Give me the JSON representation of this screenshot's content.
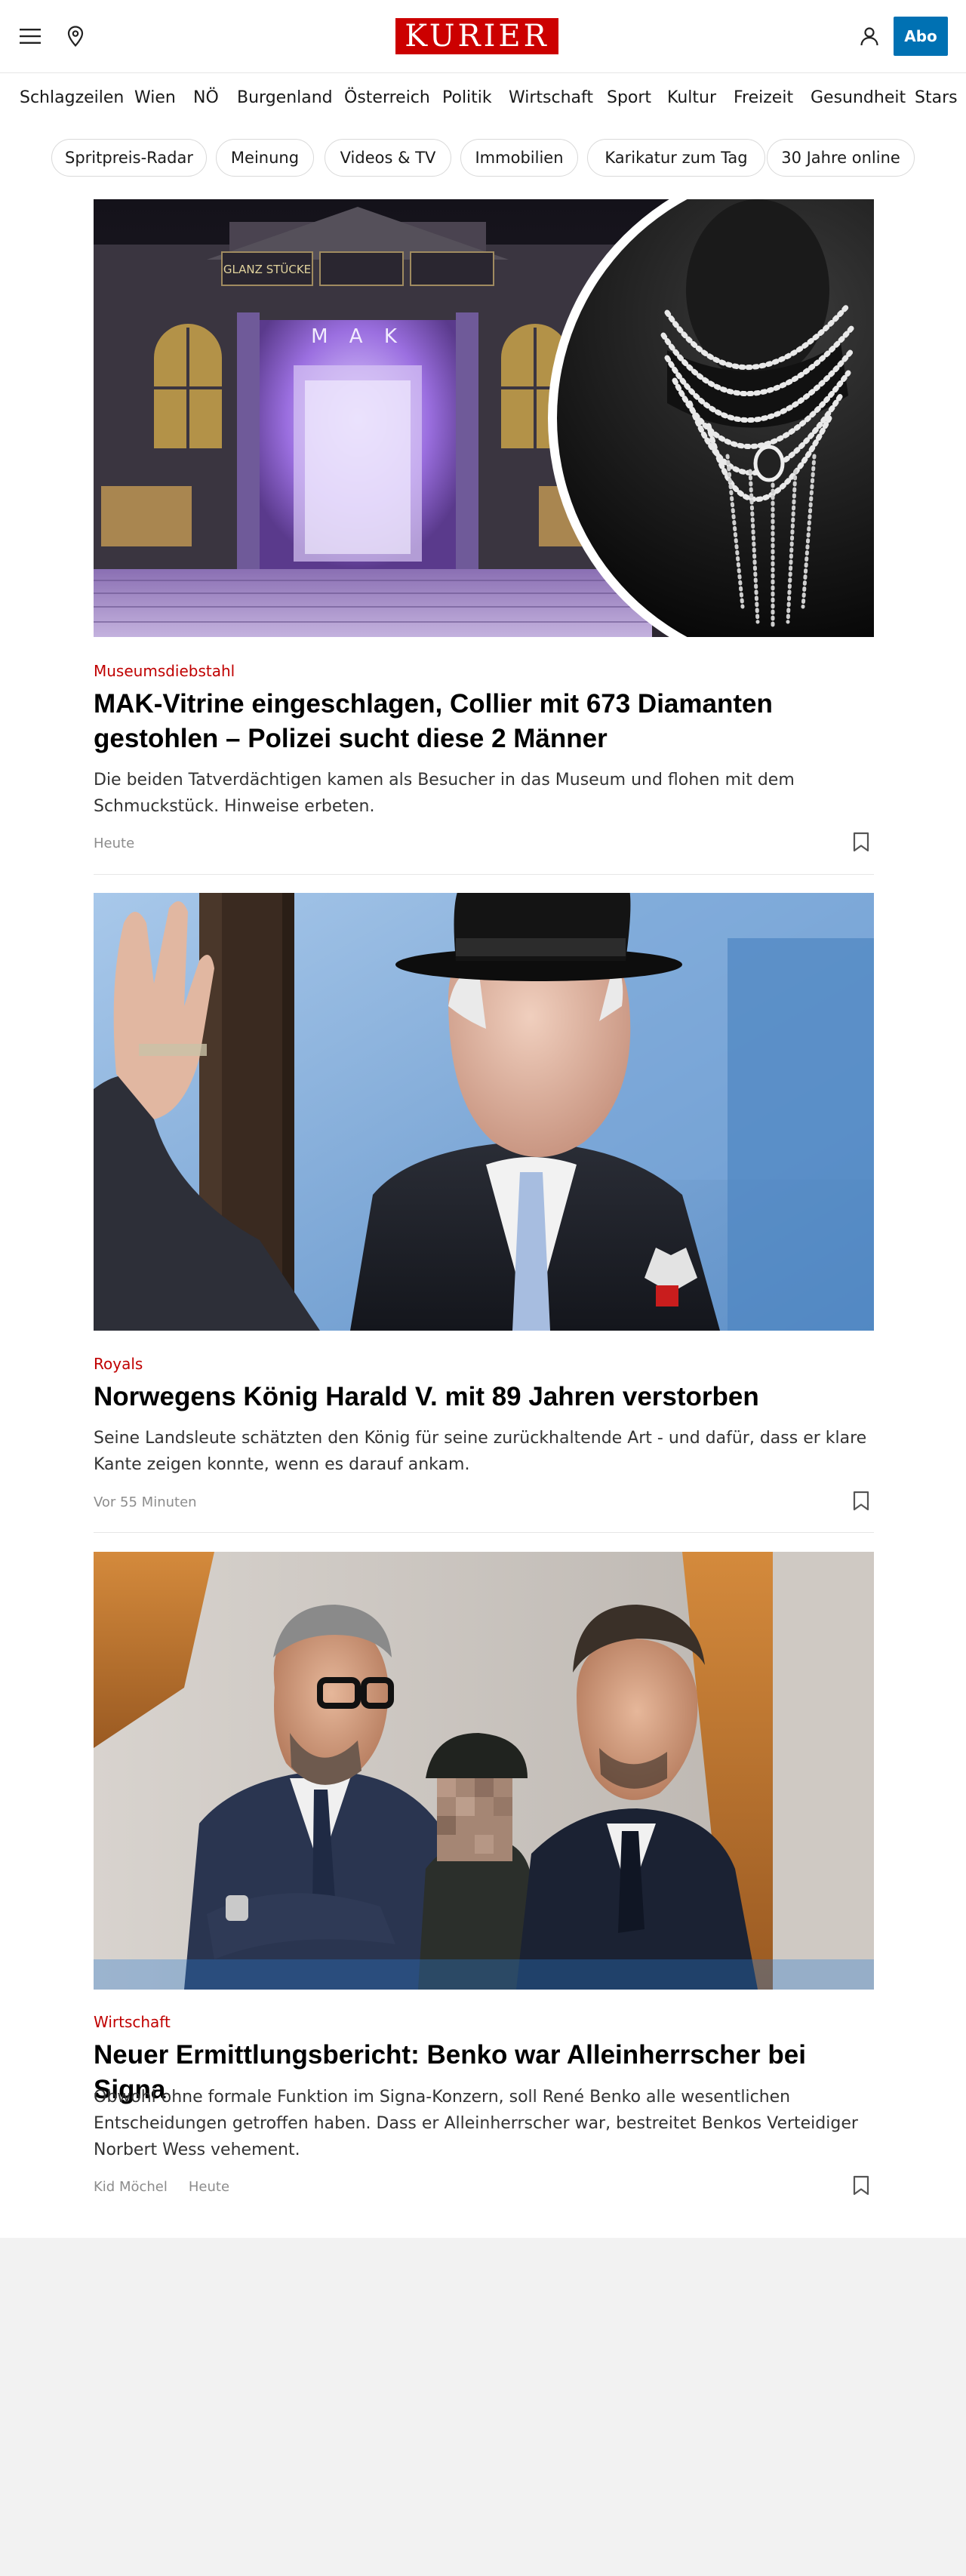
{
  "header": {
    "logo": "KURIER",
    "abo_label": "Abo",
    "menu_icon": "hamburger-menu-icon",
    "location_icon": "location-pin-icon",
    "user_icon": "user-icon",
    "brand_color": "#cc0000",
    "abo_color": "#0071b3"
  },
  "nav": {
    "items": [
      "Schlagzeilen",
      "Wien",
      "NÖ",
      "Burgenland",
      "Österreich",
      "Politik",
      "Wirtschaft",
      "Sport",
      "Kultur",
      "Freizeit",
      "Gesundheit",
      "Stars"
    ]
  },
  "chips": [
    "Spritpreis-Radar",
    "Meinung",
    "Videos & TV",
    "Immobilien",
    "Karikatur zum Tag",
    "30 Jahre online"
  ],
  "articles": [
    {
      "kicker": "Museumsdiebstahl",
      "headline": "MAK-Vitrine eingeschlagen, Collier mit 673 Diamanten gestohlen – Polizei sucht diese 2 Männer",
      "teaser": "Die beiden Tatverdächtigen kamen als Besucher in das Museum und flohen mit dem Schmuckstück. Hinweise erbeten.",
      "author": "",
      "time": "Heute",
      "image": {
        "banner_left": "GLANZ STÜCKE",
        "facade_text": "M A K"
      }
    },
    {
      "kicker": "Royals",
      "headline": "Norwegens König Harald V. mit 89 Jahren verstorben",
      "teaser": "Seine Landsleute schätzten den König für seine zurückhaltende Art - und dafür, dass er klare Kante zeigen konnte, wenn es darauf ankam.",
      "author": "",
      "time": "Vor 55 Minuten"
    },
    {
      "kicker": "Wirtschaft",
      "headline": "Neuer Ermittlungsbericht: Benko war Alleinherrscher bei Signa",
      "teaser": "Obwohl ohne formale Funktion im Signa-Konzern, soll René Benko alle wesentlichen Entscheidungen getroffen haben. Dass er Alleinherrscher war, bestreitet Benkos Verteidiger Norbert Wess vehement.",
      "author": "Kid Möchel",
      "time": "Heute"
    }
  ],
  "accent_color": "#c00000"
}
